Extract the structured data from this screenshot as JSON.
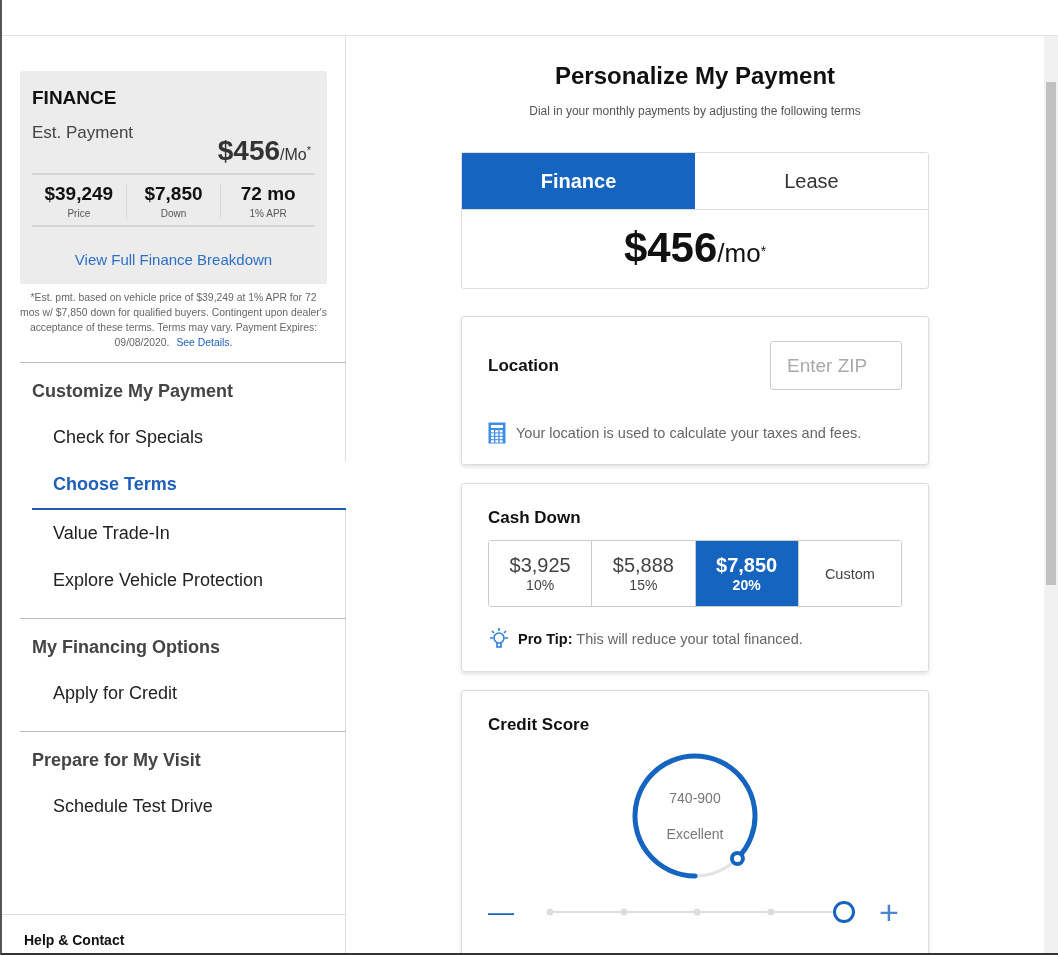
{
  "summary": {
    "title": "FINANCE",
    "est_label": "Est. Payment",
    "payment": {
      "amount": "$456",
      "unit": "/Mo",
      "mark": "*"
    },
    "stats": [
      {
        "value": "$39,249",
        "label": "Price"
      },
      {
        "value": "$7,850",
        "label": "Down"
      },
      {
        "value": "72 mo",
        "label": "1% APR"
      }
    ],
    "link": "View Full Finance Breakdown"
  },
  "disclaimer": {
    "text": "*Est. pmt. based on vehicle price of $39,249 at 1% APR for 72 mos w/ $7,850 down for qualified buyers. Contingent upon dealer's acceptance of these terms. Terms may vary. Payment Expires: 09/08/2020.",
    "link": "See Details."
  },
  "nav": [
    {
      "heading": "Customize My Payment",
      "items": [
        {
          "label": "Check for Specials",
          "selected": false
        },
        {
          "label": "Choose Terms",
          "selected": true
        },
        {
          "label": "Value Trade-In",
          "selected": false
        },
        {
          "label": "Explore Vehicle Protection",
          "selected": false
        }
      ]
    },
    {
      "heading": "My Financing Options",
      "items": [
        {
          "label": "Apply for Credit",
          "selected": false
        }
      ]
    },
    {
      "heading": "Prepare for My Visit",
      "items": [
        {
          "label": "Schedule Test Drive",
          "selected": false
        }
      ]
    }
  ],
  "help": "Help & Contact",
  "main": {
    "title": "Personalize My Payment",
    "subtitle": "Dial in your monthly payments by adjusting the following terms",
    "tabs": [
      {
        "label": "Finance",
        "selected": true
      },
      {
        "label": "Lease",
        "selected": false
      }
    ],
    "payment": {
      "amount": "$456",
      "unit": "/mo",
      "mark": "*"
    },
    "location": {
      "title": "Location",
      "placeholder": "Enter ZIP",
      "note": "Your location is used to calculate your taxes and fees."
    },
    "cash_down": {
      "title": "Cash Down",
      "options": [
        {
          "kind": "amount",
          "value": "$3,925",
          "percent": "10%",
          "selected": false
        },
        {
          "kind": "amount",
          "value": "$5,888",
          "percent": "15%",
          "selected": false
        },
        {
          "kind": "amount",
          "value": "$7,850",
          "percent": "20%",
          "selected": true
        },
        {
          "kind": "custom",
          "value": "Custom",
          "selected": false
        }
      ],
      "tip": "**Pro Tip:** This will reduce your total financed."
    },
    "credit": {
      "title": "Credit Score",
      "range": "740-900",
      "rating": "Excellent",
      "minus": "—",
      "plus": "+",
      "level": 1
    }
  }
}
